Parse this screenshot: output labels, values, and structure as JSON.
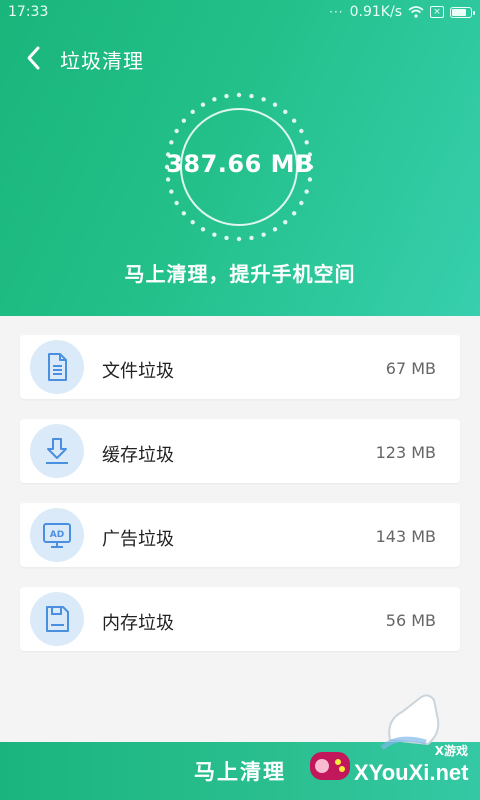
{
  "statusbar": {
    "time": "17:33",
    "dots": "···",
    "speed": "0.91K/s"
  },
  "header": {
    "title": "垃圾清理",
    "total_size": "387.66 MB",
    "slogan": "马上清理，提升手机空间"
  },
  "items": [
    {
      "label": "文件垃圾",
      "size": "67 MB",
      "icon": "file-icon"
    },
    {
      "label": "缓存垃圾",
      "size": "123 MB",
      "icon": "download-icon"
    },
    {
      "label": "广告垃圾",
      "size": "143 MB",
      "icon": "ad-icon"
    },
    {
      "label": "内存垃圾",
      "size": "56 MB",
      "icon": "memory-card-icon"
    }
  ],
  "action": {
    "clean_label": "马上清理"
  },
  "watermark": {
    "small": "X游戏",
    "text": "XYouXi.net"
  },
  "colors": {
    "accent": "#1cb67f",
    "icon_bg": "#dbeaf9",
    "icon_stroke": "#4a8fe0"
  }
}
